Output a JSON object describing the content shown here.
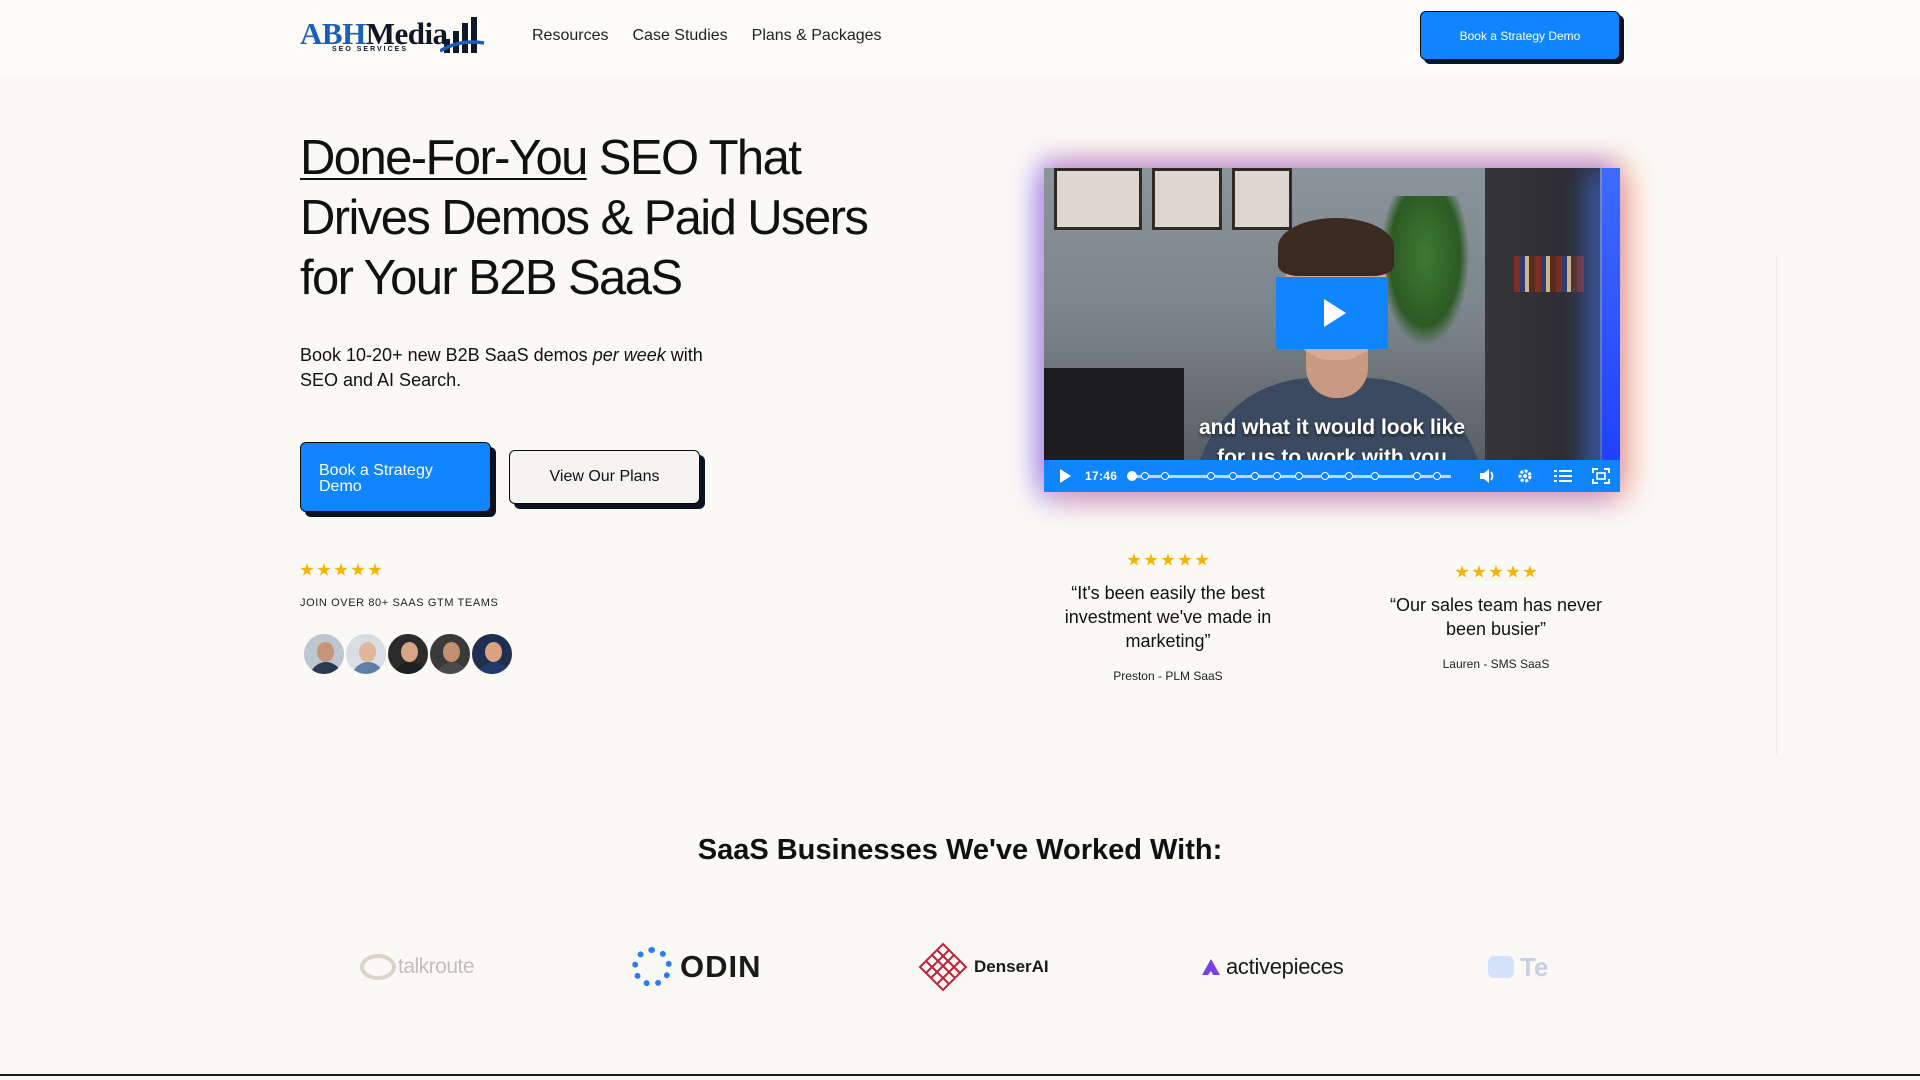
{
  "header": {
    "logo": {
      "part1": "ABH",
      "part2": "Media",
      "tagline": "SEO SERVICES"
    },
    "nav": [
      "Resources",
      "Case Studies",
      "Plans & Packages"
    ],
    "cta_label": "Book a Strategy Demo"
  },
  "hero": {
    "title_underlined": "Done-For-You",
    "title_rest": " SEO That Drives Demos & Paid Users for Your B2B SaaS",
    "subtitle_pre": "Book 10-20+ new B2B SaaS demos ",
    "subtitle_em": "per week",
    "subtitle_post": " with SEO and AI Search.",
    "primary_cta": "Book a Strategy Demo",
    "secondary_cta": "View Our Plans",
    "rating_stars": 5,
    "social_proof": "JOIN OVER 80+ SAAS GTM TEAMS",
    "avatar_count": 5
  },
  "video": {
    "caption_line1": "and what it would look like",
    "caption_line2": "for us to work with you",
    "time": "17:46",
    "chapter_markers": 12
  },
  "testimonials": [
    {
      "stars": 5,
      "quote": "“It's been easily the best investment we've made in marketing”",
      "author": "Preston - PLM SaaS"
    },
    {
      "stars": 5,
      "quote": "“Our sales team has never been busier”",
      "author": "Lauren - SMS SaaS"
    }
  ],
  "clients": {
    "title": "SaaS Businesses We've Worked With:",
    "logos": [
      "talkroute",
      "ODIN",
      "DenserAI",
      "activepieces",
      "Te"
    ]
  },
  "colors": {
    "accent": "#0f86ff",
    "star": "#f5b400",
    "background": "#fbf9f6",
    "logo_blue": "#1c5fb8"
  }
}
